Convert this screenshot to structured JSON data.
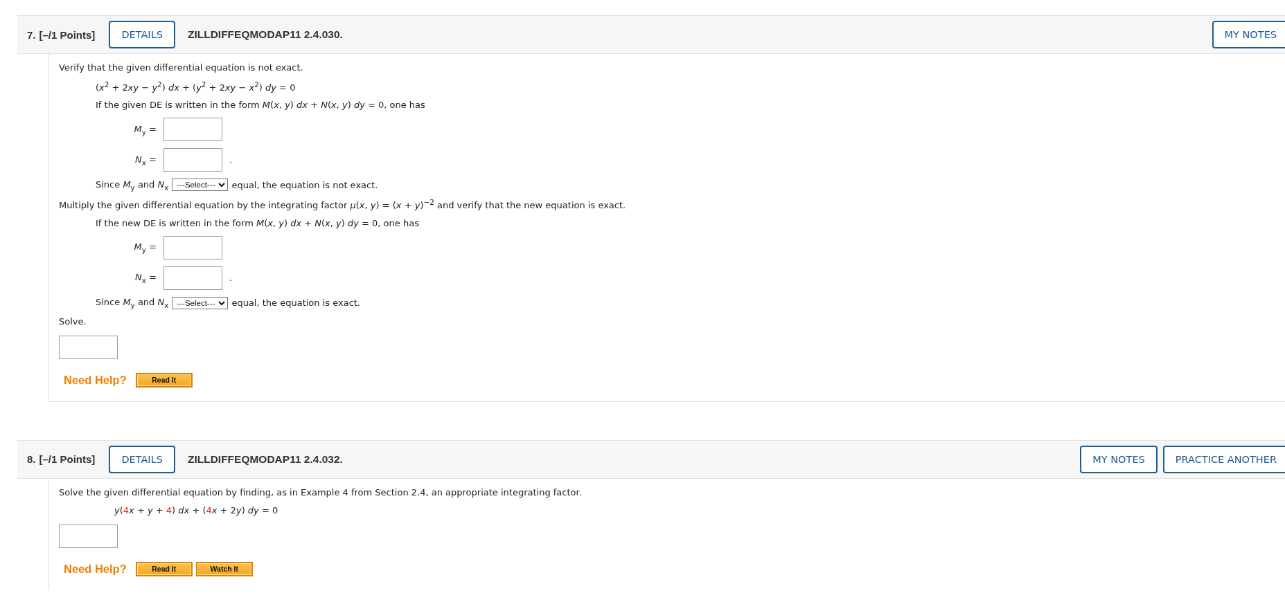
{
  "questions": [
    {
      "number": "7.",
      "points": "[–/1 Points]",
      "details": "DETAILS",
      "code": "ZILLDIFFEQMODAP11 2.4.030.",
      "header_buttons": [
        "MY NOTES"
      ],
      "body": [
        {
          "kind": "text",
          "indented": false,
          "text": "Verify that the given differential equation is not exact."
        },
        {
          "kind": "equation",
          "segments": [
            {
              "text": "(*x*$^{2}$ + 2",
              "color": "#222222"
            },
            {
              "text": "*xy* − *y*$^{2}$) *dx* + (*y*$^{2}$ + 2",
              "color": "#222222"
            },
            {
              "text": "*xy* − *x*$^{2}$) *dy* = 0",
              "color": "#222222"
            }
          ]
        },
        {
          "kind": "text",
          "indented": true,
          "text": "If the given DE is written in the form *M*(*x*, *y*) *dx* + *N*(*x*, *y*) *dy* = 0, one has"
        },
        {
          "kind": "answer",
          "label": "*M*$_{y}$ ="
        },
        {
          "kind": "answer",
          "label": "*N*$_{x}$ =",
          "after": "."
        },
        {
          "kind": "select",
          "before": "Since *M*$_{y}$ and *N*$_{x}$",
          "option": "---Select---",
          "after": "equal, the equation is not exact."
        },
        {
          "kind": "text",
          "indented": false,
          "text": "Multiply the given differential equation by the integrating factor *μ*(*x*, *y*) = (*x* + *y*)$^{−2}$ and verify that the new equation is exact."
        },
        {
          "kind": "text",
          "indented": true,
          "text": "If the new DE is written in the form *M*(*x*, *y*) *dx* + *N*(*x*, *y*) *dy* = 0, one has"
        },
        {
          "kind": "answer",
          "label": "*M*$_{y}$ ="
        },
        {
          "kind": "answer",
          "label": "*N*$_{x}$ =",
          "after": "."
        },
        {
          "kind": "select",
          "before": "Since *M*$_{y}$ and *N*$_{x}$",
          "option": "---Select---",
          "after": "equal, the equation is exact."
        },
        {
          "kind": "text",
          "indented": false,
          "text": "Solve."
        },
        {
          "kind": "blank"
        }
      ],
      "help_label": "Need Help?",
      "help_buttons": [
        "Read It"
      ]
    },
    {
      "number": "8.",
      "points": "[–/1 Points]",
      "details": "DETAILS",
      "code": "ZILLDIFFEQMODAP11 2.4.032.",
      "header_buttons": [
        "MY NOTES",
        "PRACTICE ANOTHER"
      ],
      "body": [
        {
          "kind": "text",
          "indented": false,
          "text": "Solve the given differential equation by finding, as in Example 4 from Section 2.4, an appropriate integrating factor."
        },
        {
          "kind": "display_equation",
          "segments": [
            {
              "text": "*y*(",
              "color": "#222222"
            },
            {
              "text": "4",
              "color": "#dd1c1c"
            },
            {
              "text": "*x* + *y* + ",
              "color": "#222222"
            },
            {
              "text": "4",
              "color": "#dd1c1c"
            },
            {
              "text": ") *dx* + (",
              "color": "#222222"
            },
            {
              "text": "4",
              "color": "#dd1c1c"
            },
            {
              "text": "*x* + 2",
              "color": "#222222"
            },
            {
              "text": "*y*) *dy* = 0",
              "color": "#222222"
            }
          ]
        },
        {
          "kind": "blank"
        }
      ],
      "help_label": "Need Help?",
      "help_buttons": [
        "Read It",
        "Watch It"
      ]
    }
  ]
}
